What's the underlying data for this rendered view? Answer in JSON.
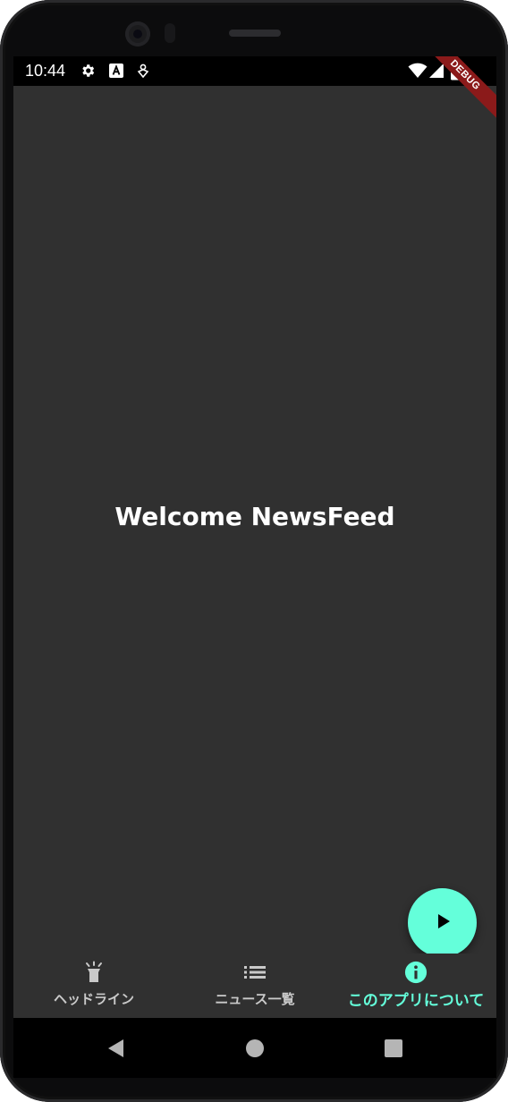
{
  "status_bar": {
    "time": "10:44",
    "left_icons": [
      "settings-icon",
      "font-a-icon",
      "location-pin-icon"
    ],
    "right_icons": [
      "wifi-icon",
      "cell-signal-icon",
      "battery-icon"
    ],
    "debug_label": "DEBUG",
    "debug_color": "#8b1a1a"
  },
  "main": {
    "title": "Welcome NewsFeed"
  },
  "fab": {
    "icon": "play-icon",
    "color": "#64ffda"
  },
  "bottom_nav": {
    "items": [
      {
        "label": "ヘッドライン",
        "icon": "flashlight-icon",
        "active": false
      },
      {
        "label": "ニュース一覧",
        "icon": "list-icon",
        "active": false
      },
      {
        "label": "このアプリについて",
        "icon": "info-icon",
        "active": true
      }
    ],
    "active_color": "#64ffda"
  },
  "system_nav": {
    "buttons": [
      "back-icon",
      "home-icon",
      "recents-icon"
    ]
  }
}
